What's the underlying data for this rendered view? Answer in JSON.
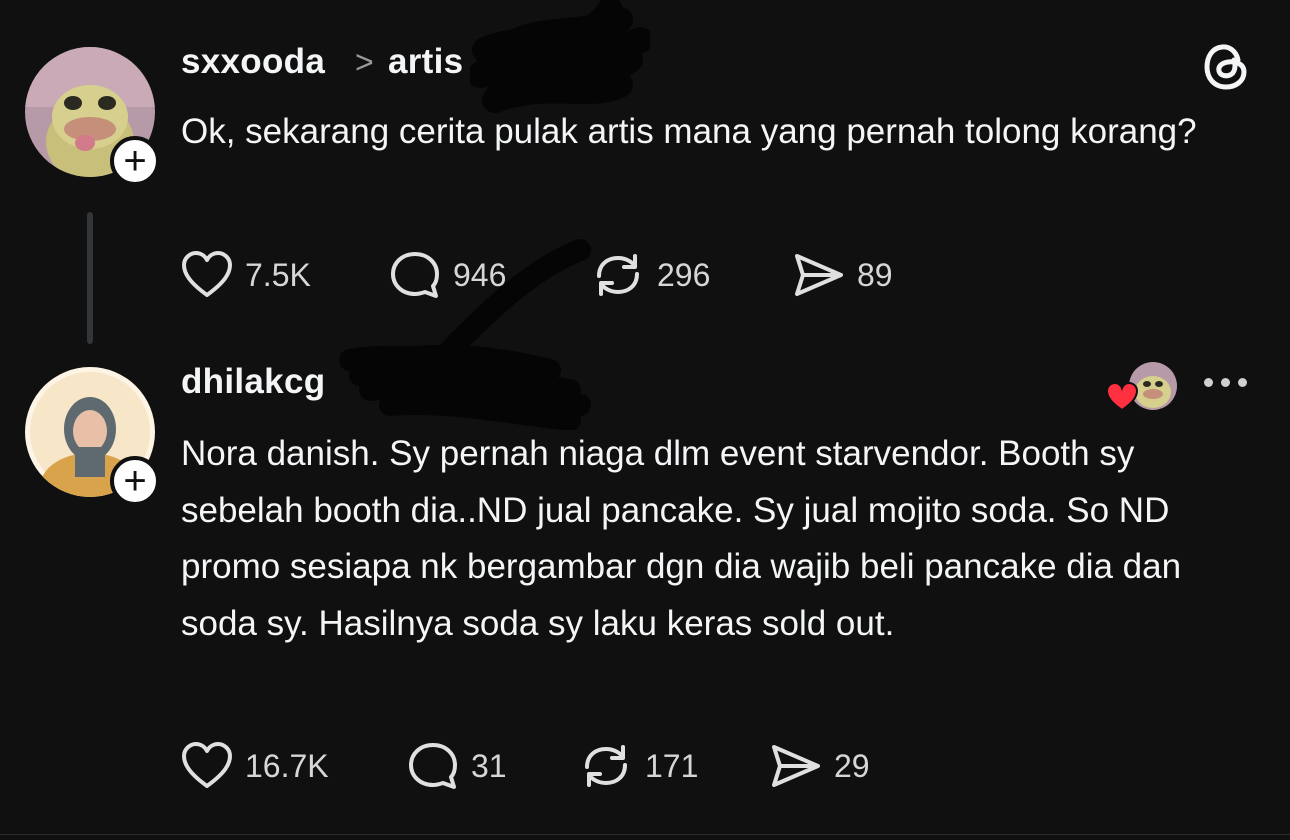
{
  "app": {
    "logo_icon": "threads-logo-icon"
  },
  "post": {
    "username": "sxxooda",
    "breadcrumb_separator": ">",
    "topic": "artis",
    "text": "Ok, sekarang cerita pulak artis mana yang pernah tolong korang?",
    "actions": {
      "likes": "7.5K",
      "replies": "946",
      "reposts": "296",
      "shares": "89"
    }
  },
  "reply": {
    "username": "dhilakcg",
    "text": "Nora danish. Sy pernah niaga dlm event starvendor. Booth sy sebelah booth dia..ND jual pancake. Sy jual mojito soda. So ND promo sesiapa nk bergambar dgn dia wajib beli pancake dia dan soda sy. Hasilnya soda sy laku keras sold out.",
    "liked_by_author": true,
    "actions": {
      "likes": "16.7K",
      "replies": "31",
      "reposts": "171",
      "shares": "29"
    }
  },
  "colors": {
    "background": "#101010",
    "text": "#f3f5f7",
    "liked_heart": "#ff3040"
  }
}
